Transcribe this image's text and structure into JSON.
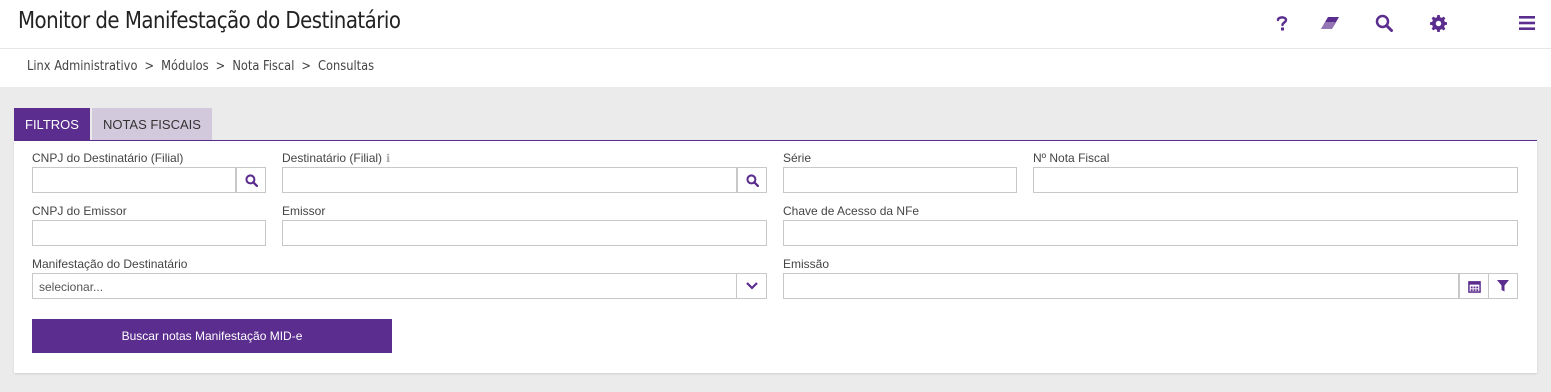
{
  "header": {
    "title": "Monitor de Manifestação do Destinatário",
    "icons": [
      "help-icon",
      "eraser-icon",
      "search-icon",
      "gear-icon",
      "menu-icon"
    ],
    "accent": "#5b2d8e"
  },
  "breadcrumb": [
    "Linx Administrativo",
    "Módulos",
    "Nota Fiscal",
    "Consultas"
  ],
  "breadcrumb_separator": ">",
  "tabs": [
    {
      "label": "FILTROS",
      "active": true
    },
    {
      "label": "NOTAS FISCAIS",
      "active": false
    }
  ],
  "form": {
    "cnpj_destinatario": {
      "label": "CNPJ do Destinatário (Filial)",
      "value": ""
    },
    "destinatario": {
      "label": "Destinatário (Filial)",
      "value": ""
    },
    "serie": {
      "label": "Série",
      "value": ""
    },
    "nota_fiscal": {
      "label": "Nº Nota Fiscal",
      "value": ""
    },
    "cnpj_emissor": {
      "label": "CNPJ do Emissor",
      "value": ""
    },
    "emissor": {
      "label": "Emissor",
      "value": ""
    },
    "chave_acesso": {
      "label": "Chave de Acesso da NFe",
      "value": ""
    },
    "manifestacao": {
      "label": "Manifestação do Destinatário",
      "value": "selecionar..."
    },
    "emissao": {
      "label": "Emissão",
      "value": ""
    }
  },
  "search_button": "Buscar notas Manifestação MID-e"
}
